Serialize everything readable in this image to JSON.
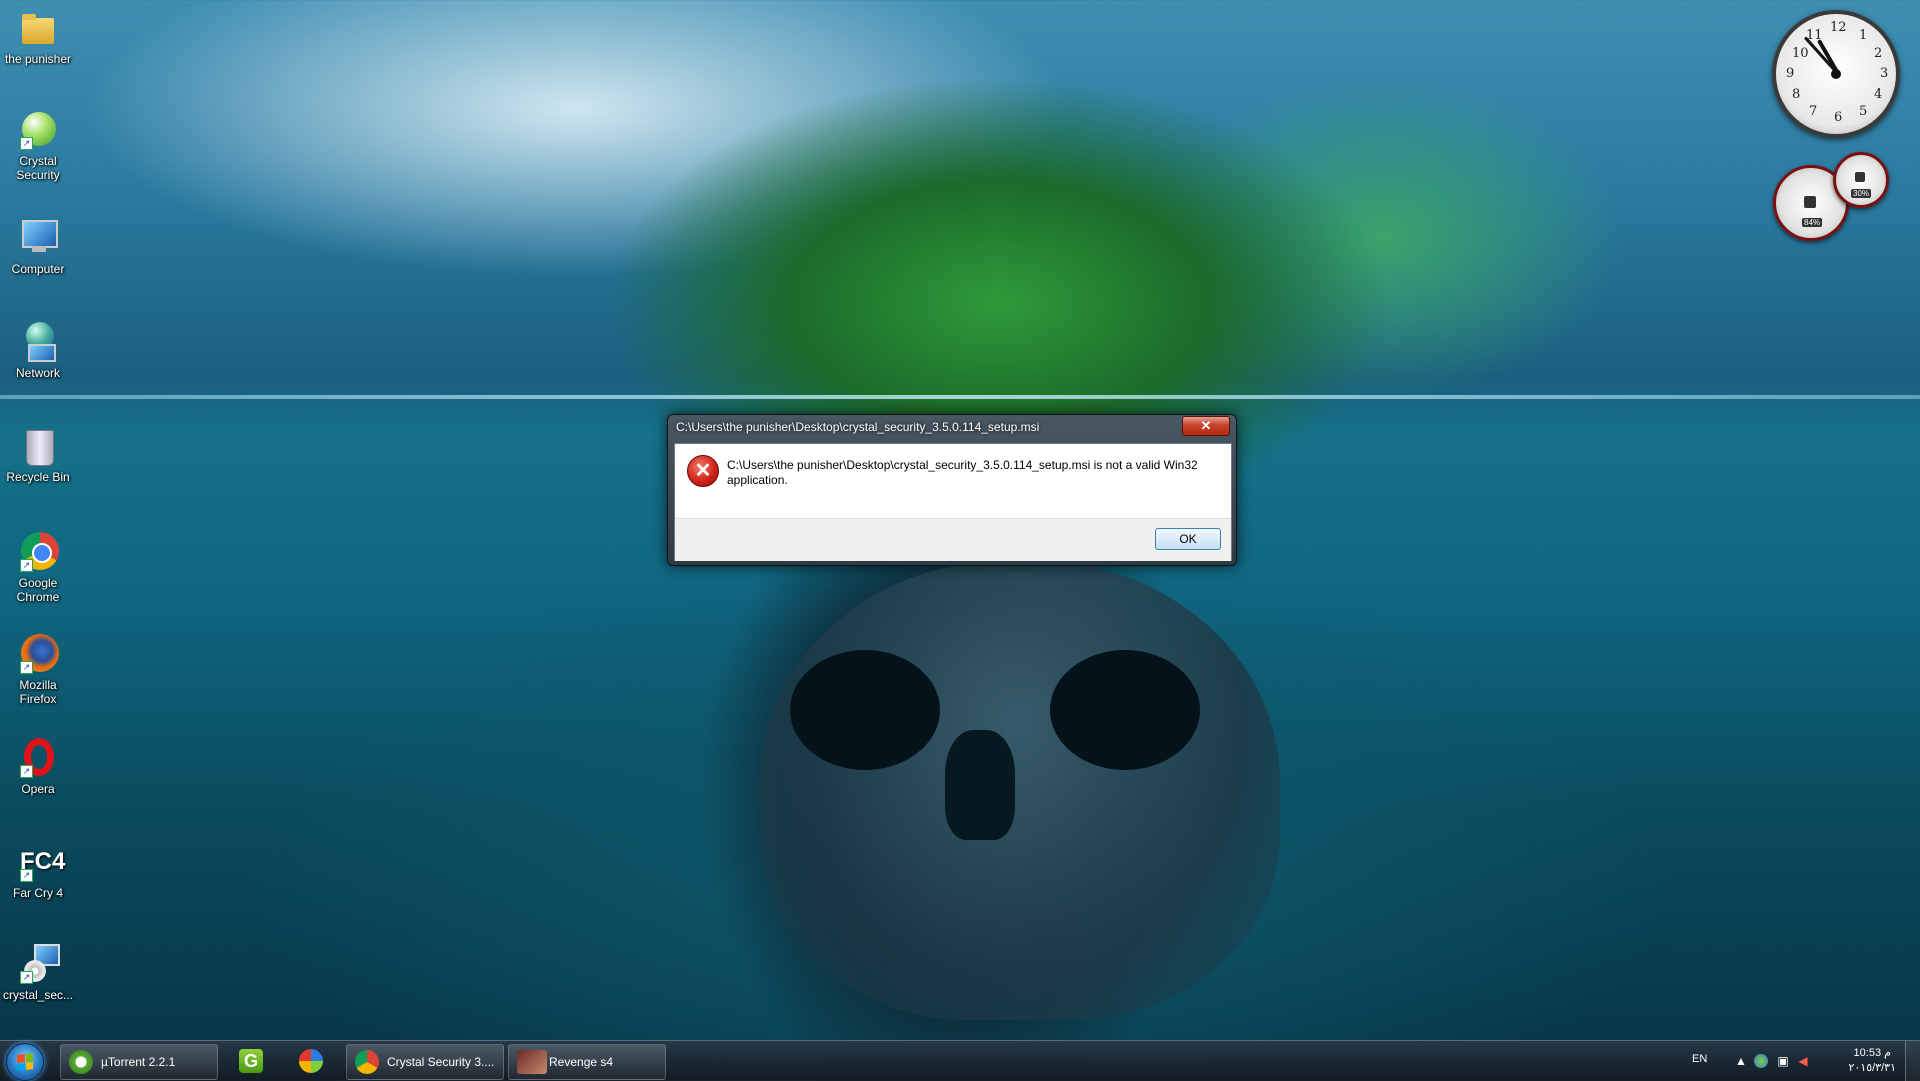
{
  "desktop_icons": [
    {
      "label": "the punisher",
      "icon": "folder-icon"
    },
    {
      "label": "Crystal Security",
      "icon": "crystal-security-icon"
    },
    {
      "label": "Computer",
      "icon": "computer-icon"
    },
    {
      "label": "Network",
      "icon": "network-icon"
    },
    {
      "label": "Recycle Bin",
      "icon": "recycle-bin-icon"
    },
    {
      "label": "Google Chrome",
      "icon": "chrome-icon"
    },
    {
      "label": "Mozilla Firefox",
      "icon": "firefox-icon"
    },
    {
      "label": "Opera",
      "icon": "opera-icon"
    },
    {
      "label": "Far Cry 4",
      "icon": "far-cry-4-icon",
      "badge": "FC4"
    },
    {
      "label": "crystal_sec...",
      "icon": "installer-icon"
    }
  ],
  "gadgets": {
    "clock_numbers": [
      "12",
      "1",
      "2",
      "3",
      "4",
      "5",
      "6",
      "7",
      "8",
      "9",
      "10",
      "11"
    ],
    "cpu_meter": {
      "cpu_label": "84%",
      "ram_label": "30%"
    }
  },
  "dialog": {
    "title": "C:\\Users\\the punisher\\Desktop\\crystal_security_3.5.0.114_setup.msi",
    "close_label": "✕",
    "message": "C:\\Users\\the punisher\\Desktop\\crystal_security_3.5.0.114_setup.msi is not a valid Win32 application.",
    "ok_label": "OK"
  },
  "taskbar": {
    "items": [
      {
        "label": "µTorrent 2.2.1",
        "icon": "utorrent-icon"
      },
      {
        "label": "",
        "icon": "green-g-icon"
      },
      {
        "label": "",
        "icon": "download-manager-icon"
      },
      {
        "label": "Crystal Security 3....",
        "icon": "chrome-icon"
      },
      {
        "label": "Revenge s4",
        "icon": "revenge-icon"
      }
    ],
    "tray": {
      "language": "EN",
      "time": "10:53 م",
      "date": "٢٠١٥/٣/٣١"
    }
  },
  "colors": {
    "accent": "#2b7fc9",
    "error_red": "#d0241a",
    "close_red": "#c8432a"
  }
}
